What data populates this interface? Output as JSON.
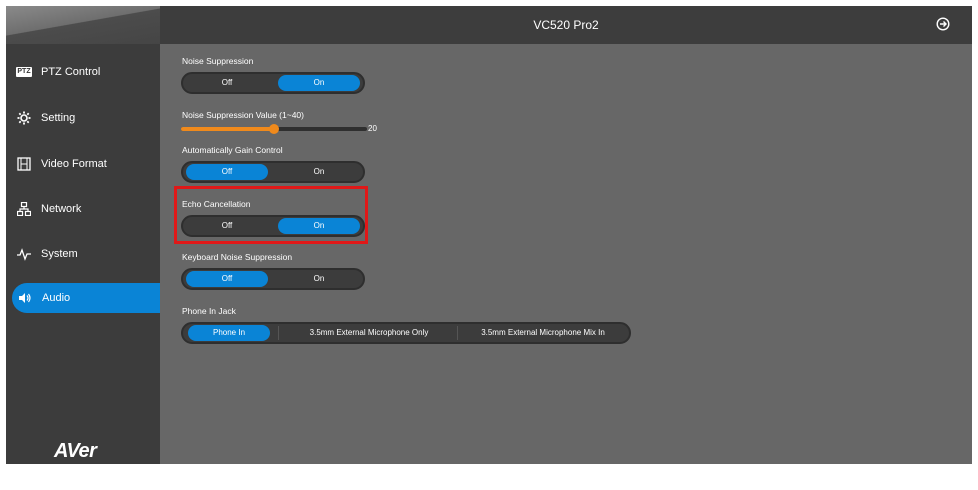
{
  "app": {
    "title": "VC520 Pro2",
    "exit_icon": "exit-icon",
    "logo_text": "AVer"
  },
  "sidebar": {
    "items": [
      {
        "label": "PTZ Control",
        "icon": "ptz-icon",
        "badge": "PTZ"
      },
      {
        "label": "Setting",
        "icon": "gear-icon"
      },
      {
        "label": "Video Format",
        "icon": "film-icon"
      },
      {
        "label": "Network",
        "icon": "network-icon"
      },
      {
        "label": "System",
        "icon": "pulse-icon"
      },
      {
        "label": "Audio",
        "icon": "speaker-icon",
        "active": true
      }
    ]
  },
  "audio": {
    "noise_suppression": {
      "label": "Noise Suppression",
      "off": "Off",
      "on": "On",
      "selected": "On"
    },
    "noise_suppression_value": {
      "label": "Noise Suppression Value (1~40)",
      "value": "20",
      "fraction": 0.5
    },
    "agc": {
      "label": "Automatically Gain Control",
      "off": "Off",
      "on": "On",
      "selected": "Off"
    },
    "echo_cancellation": {
      "label": "Echo Cancellation",
      "off": "Off",
      "on": "On",
      "selected": "On"
    },
    "keyboard_noise": {
      "label": "Keyboard Noise Suppression",
      "off": "Off",
      "on": "On",
      "selected": "Off"
    },
    "phone_in_jack": {
      "label": "Phone In Jack",
      "options": [
        "Phone In",
        "3.5mm External Microphone Only",
        "3.5mm External Microphone Mix In"
      ],
      "selected": "Phone In"
    }
  },
  "colors": {
    "accent": "#0a84d6",
    "slider": "#f08a1c",
    "highlight": "#e01818",
    "panel": "#676767",
    "sidebar": "#3c3c3c"
  }
}
